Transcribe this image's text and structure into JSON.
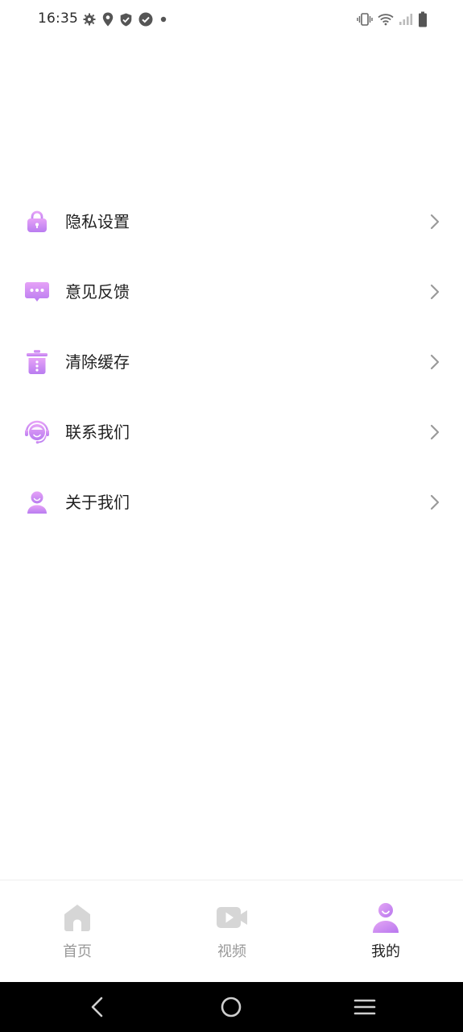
{
  "status_bar": {
    "time": "16:35",
    "left_icons": [
      "settings-icon",
      "location-icon",
      "shield-icon",
      "check-circle-icon",
      "dot-icon"
    ],
    "right_icons": [
      "vibrate-icon",
      "wifi-icon",
      "signal-icon",
      "battery-icon"
    ]
  },
  "menu": {
    "items": [
      {
        "label": "隐私设置",
        "icon": "lock-icon"
      },
      {
        "label": "意见反馈",
        "icon": "chat-bubble-icon"
      },
      {
        "label": "清除缓存",
        "icon": "trash-icon"
      },
      {
        "label": "联系我们",
        "icon": "headset-icon"
      },
      {
        "label": "关于我们",
        "icon": "user-icon"
      }
    ]
  },
  "bottom_nav": {
    "tabs": [
      {
        "label": "首页",
        "icon": "home-icon",
        "active": false
      },
      {
        "label": "视频",
        "icon": "video-icon",
        "active": false
      },
      {
        "label": "我的",
        "icon": "profile-icon",
        "active": true
      }
    ]
  },
  "colors": {
    "accent_start": "#d98bf2",
    "accent_end": "#b57af0",
    "inactive_icon": "#d8d8d8",
    "label": "#1f1f1f",
    "inactive_label": "#999999"
  },
  "system_nav": [
    "back-icon",
    "home-circle-icon",
    "recents-icon"
  ]
}
